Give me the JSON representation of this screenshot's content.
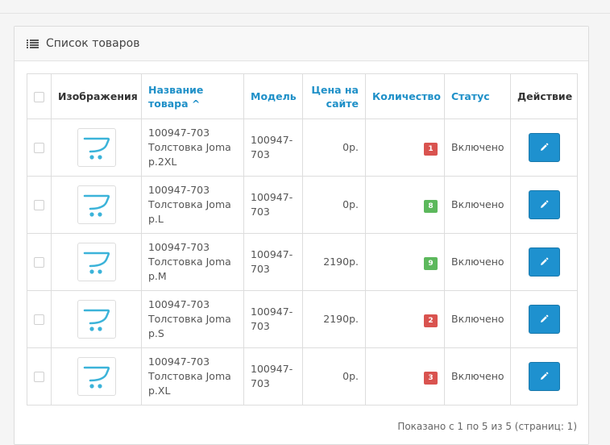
{
  "panel": {
    "title": "Список товаров",
    "icon": "list-icon"
  },
  "table": {
    "headers": {
      "image": "Изображения",
      "name": "Название товара",
      "model": "Модель",
      "price": "Цена на сайте",
      "quantity": "Количество",
      "status": "Статус",
      "action": "Действие"
    },
    "sort_indicator": "^",
    "rows": [
      {
        "name": "100947-703 Толстовка Joma р.2XL",
        "model": "100947-703",
        "price": "0р.",
        "quantity": "1",
        "quantity_color": "#d9534f",
        "status": "Включено"
      },
      {
        "name": "100947-703 Толстовка Joma р.L",
        "model": "100947-703",
        "price": "0р.",
        "quantity": "8",
        "quantity_color": "#5cb85c",
        "status": "Включено"
      },
      {
        "name": "100947-703 Толстовка Joma р.M",
        "model": "100947-703",
        "price": "2190р.",
        "quantity": "9",
        "quantity_color": "#5cb85c",
        "status": "Включено"
      },
      {
        "name": "100947-703 Толстовка Joma р.S",
        "model": "100947-703",
        "price": "2190р.",
        "quantity": "2",
        "quantity_color": "#d9534f",
        "status": "Включено"
      },
      {
        "name": "100947-703 Толстовка Joma р.XL",
        "model": "100947-703",
        "price": "0р.",
        "quantity": "3",
        "quantity_color": "#d9534f",
        "status": "Включено"
      }
    ]
  },
  "pagination": {
    "info": "Показано с 1 по 5 из 5 (страниц: 1)"
  },
  "colors": {
    "link": "#1f90c8",
    "edit_button": "#1e91cf",
    "cart_icon": "#3bb3d9"
  }
}
